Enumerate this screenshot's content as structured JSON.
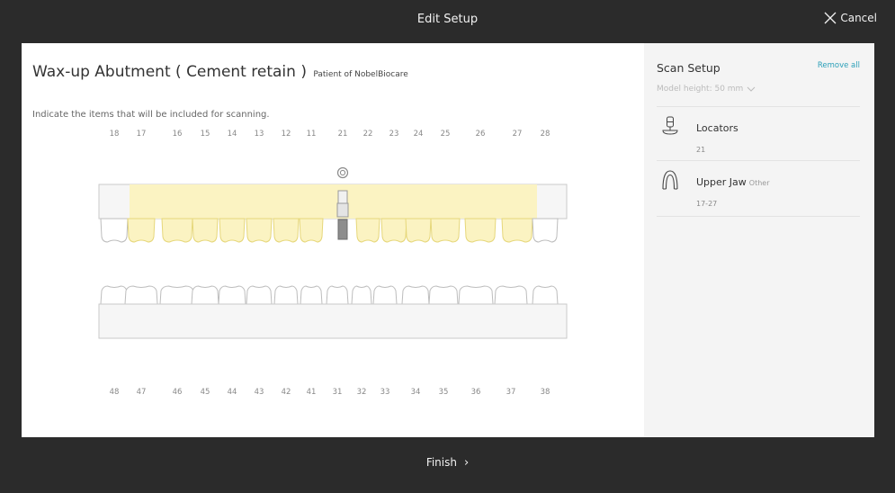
{
  "header": {
    "title": "Edit Setup",
    "cancel_label": "Cancel"
  },
  "main": {
    "title": "Wax-up Abutment ( Cement retain )",
    "subtitle": "Patient of NobelBiocare",
    "instruction": "Indicate the items that will be included for scanning."
  },
  "upper_teeth": [
    "18",
    "17",
    "16",
    "15",
    "14",
    "13",
    "12",
    "11",
    "21",
    "22",
    "23",
    "24",
    "25",
    "26",
    "27",
    "28"
  ],
  "lower_teeth": [
    "48",
    "47",
    "46",
    "45",
    "44",
    "43",
    "42",
    "41",
    "31",
    "32",
    "33",
    "34",
    "35",
    "36",
    "37",
    "38"
  ],
  "scan_setup": {
    "title": "Scan Setup",
    "remove_all": "Remove all",
    "model_height": "Model height: 50 mm",
    "items": [
      {
        "label": "Locators",
        "extra": "",
        "detail": "21",
        "icon": "locator-icon"
      },
      {
        "label": "Upper Jaw",
        "extra": "Other",
        "detail": "17-27",
        "icon": "upper-jaw-icon"
      }
    ]
  },
  "footer": {
    "finish_label": "Finish"
  },
  "colors": {
    "highlight": "#fbf3c2",
    "highlight_border": "#e6d77a",
    "accent": "#2a9fb8"
  }
}
